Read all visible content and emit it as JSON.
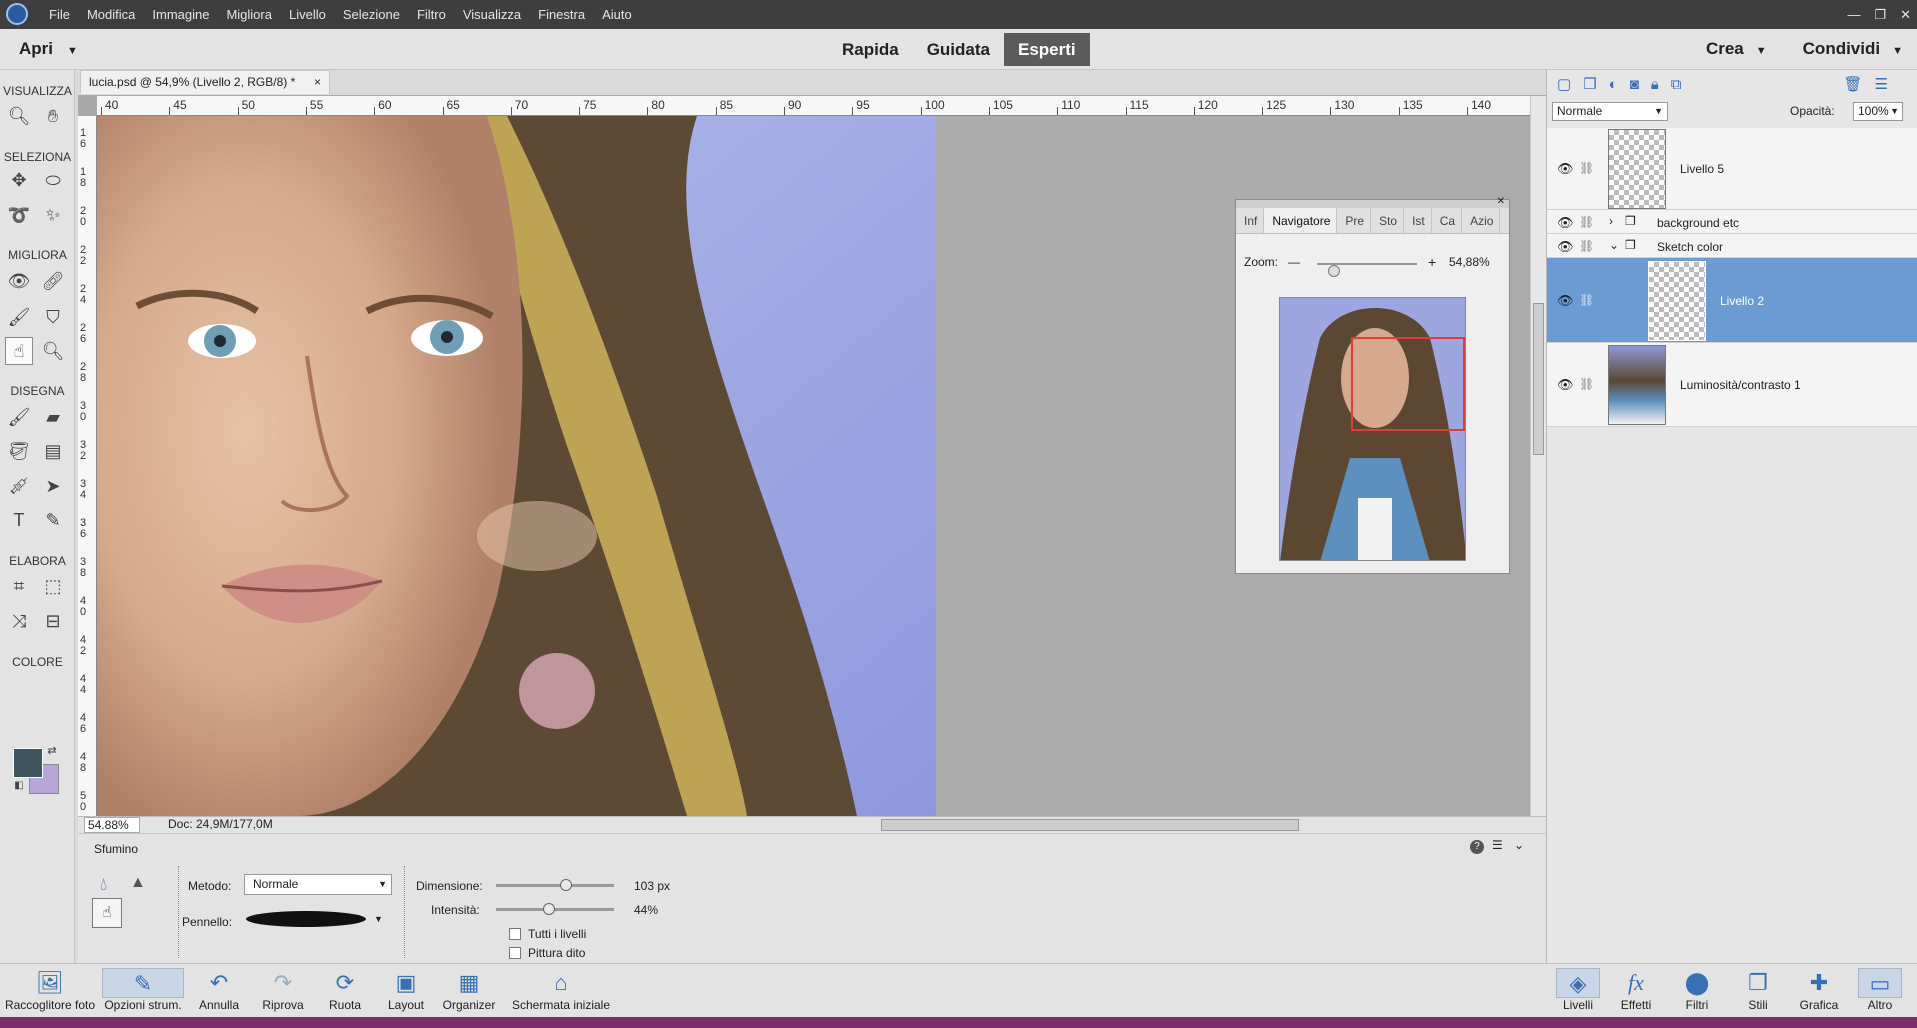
{
  "menubar": {
    "items": [
      "File",
      "Modifica",
      "Immagine",
      "Migliora",
      "Livello",
      "Selezione",
      "Filtro",
      "Visualizza",
      "Finestra",
      "Aiuto"
    ],
    "window_controls": [
      "—",
      "❐",
      "✕"
    ]
  },
  "modebar": {
    "open_label": "Apri",
    "modes": [
      "Rapida",
      "Guidata",
      "Esperti"
    ],
    "active_mode": "Esperti",
    "create_label": "Crea",
    "share_label": "Condividi"
  },
  "toolbox": {
    "sections": [
      "VISUALIZZA",
      "SELEZIONA",
      "MIGLIORA",
      "DISEGNA",
      "ELABORA",
      "COLORE"
    ],
    "foreground_color": "#3f5660",
    "background_color": "#b7a6d7"
  },
  "document": {
    "tab_title": "lucia.psd @ 54,9% (Livello 2, RGB/8) *",
    "close_glyph": "×"
  },
  "ruler": {
    "h_ticks": [
      "40",
      "45",
      "50",
      "55",
      "60",
      "65",
      "70",
      "75",
      "80",
      "85",
      "90",
      "95",
      "100",
      "105",
      "110",
      "115",
      "120",
      "125",
      "130",
      "135",
      "140"
    ],
    "v_ticks": [
      "16",
      "18",
      "20",
      "22",
      "24",
      "26",
      "28",
      "30",
      "32",
      "34",
      "36",
      "38",
      "40",
      "42",
      "44",
      "46",
      "48",
      "50"
    ]
  },
  "status": {
    "zoom": "54.88%",
    "doc": "Doc: 24,9M/177,0M"
  },
  "navigator": {
    "tabs": [
      "Inf",
      "Navigatore",
      "Pre",
      "Sto",
      "Ist",
      "Ca",
      "Azio"
    ],
    "active_tab": "Navigatore",
    "zoom_label": "Zoom:",
    "zoom_value": "54,88%",
    "zoom_level_fraction": 0.12
  },
  "layers": {
    "blend_mode": "Normale",
    "opacity_label": "Opacità:",
    "opacity_value": "100%",
    "items": [
      {
        "name": "Livello 5",
        "type": "layer"
      },
      {
        "name": "background etc",
        "type": "group"
      },
      {
        "name": "Sketch color",
        "type": "group"
      },
      {
        "name": "Livello 2",
        "type": "layer",
        "selected": true
      },
      {
        "name": "Luminosità/contrasto 1",
        "type": "adjustment"
      }
    ]
  },
  "options": {
    "tool_name": "Sfumino",
    "method_label": "Metodo:",
    "method_value": "Normale",
    "brush_label": "Pennello:",
    "size_label": "Dimensione:",
    "size_value": "103 px",
    "size_fraction": 0.6,
    "strength_label": "Intensità:",
    "strength_value": "44%",
    "strength_fraction": 0.44,
    "all_layers_label": "Tutti i livelli",
    "finger_paint_label": "Pittura dito",
    "help_glyph": "?"
  },
  "bottombar": {
    "left": [
      {
        "label": "Raccoglitore foto",
        "icon": "photo-bin-icon"
      },
      {
        "label": "Opzioni strum.",
        "icon": "tool-options-icon"
      },
      {
        "label": "Annulla",
        "icon": "undo-icon"
      },
      {
        "label": "Riprova",
        "icon": "redo-icon"
      },
      {
        "label": "Ruota",
        "icon": "rotate-icon"
      },
      {
        "label": "Layout",
        "icon": "layout-icon"
      },
      {
        "label": "Organizer",
        "icon": "organizer-icon"
      },
      {
        "label": "Schermata iniziale",
        "icon": "home-icon"
      }
    ],
    "right": [
      {
        "label": "Livelli",
        "icon": "layers-icon"
      },
      {
        "label": "Effetti",
        "icon": "effects-icon"
      },
      {
        "label": "Filtri",
        "icon": "filters-icon"
      },
      {
        "label": "Stili",
        "icon": "styles-icon"
      },
      {
        "label": "Grafica",
        "icon": "graphics-icon"
      },
      {
        "label": "Altro",
        "icon": "more-icon"
      }
    ]
  }
}
